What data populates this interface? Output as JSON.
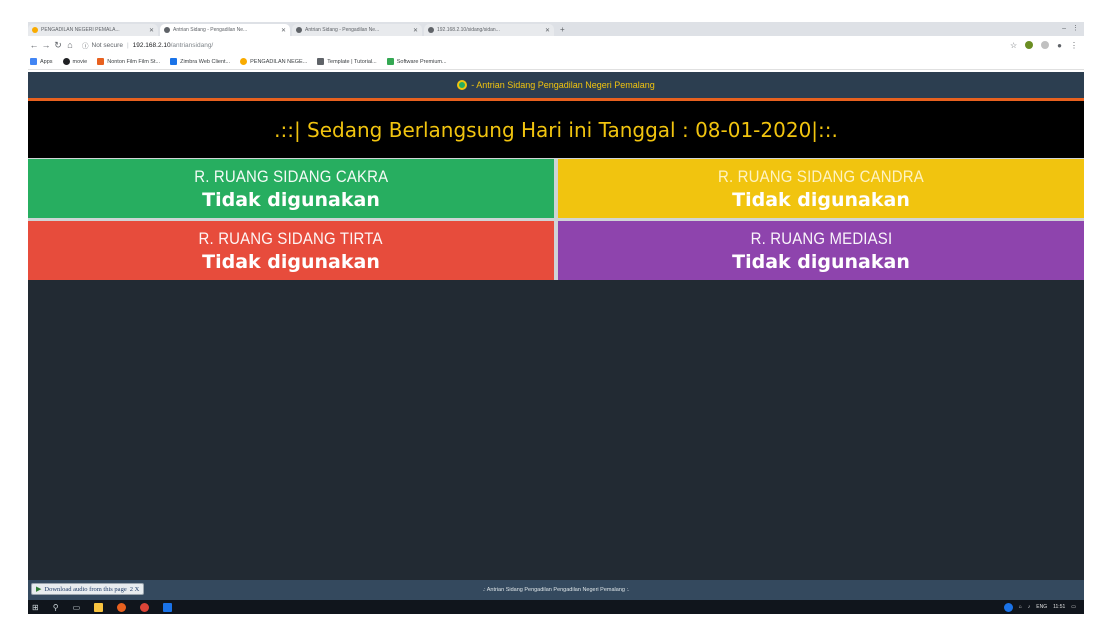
{
  "browser": {
    "tabs": [
      {
        "label": "PENGADILAN NEGERI PEMALA...",
        "active": false
      },
      {
        "label": "Antrian Sidang - Pengadilan Ne...",
        "active": true
      },
      {
        "label": "Antrian Sidang - Pengadilan Ne...",
        "active": false
      },
      {
        "label": "192.168.2.10/sidang/sidan...",
        "active": false
      }
    ],
    "new_tab": "+",
    "security_label": "Not secure",
    "url_host": "192.168.2.10",
    "url_path": "/antriansidang/",
    "bookmarks": [
      {
        "label": "Apps",
        "color": "#4285f4"
      },
      {
        "label": "movie",
        "color": "#202124"
      },
      {
        "label": "Nonton Film Film St...",
        "color": "#e8611f"
      },
      {
        "label": "Zimbra Web Client...",
        "color": "#1a73e8"
      },
      {
        "label": "PENGADILAN NEGE...",
        "color": "#f9ab00"
      },
      {
        "label": "Template | Tutorial...",
        "color": "#5f6368"
      },
      {
        "label": "Software Premium...",
        "color": "#34a853"
      }
    ]
  },
  "header": {
    "title": "- Antrian Sidang Pengadilan Negeri Pemalang"
  },
  "banner": {
    "text": ".::| Sedang Berlangsung Hari ini Tanggal : 08-01-2020|::."
  },
  "rooms": [
    {
      "name": "R. RUANG SIDANG CAKRA",
      "status": "Tidak digunakan",
      "color": "#27ae60"
    },
    {
      "name": "R. RUANG SIDANG CANDRA",
      "status": "Tidak digunakan",
      "color": "#f1c40f"
    },
    {
      "name": "R. RUANG SIDANG TIRTA",
      "status": "Tidak digunakan",
      "color": "#e74c3c"
    },
    {
      "name": "R. RUANG MEDIASI",
      "status": "Tidak digunakan",
      "color": "#8e44ad"
    }
  ],
  "download_box": {
    "label": "Download audio from this page",
    "extra": "2 X"
  },
  "footer": {
    "text": ".: Antrian Sidang Pengadilan Pengadilan Negeri Pemalang :."
  },
  "taskbar": {
    "lang": "ENG",
    "time": "11:51"
  },
  "colors": {
    "accent_orange": "#e8611f",
    "title_yellow": "#f1c40f",
    "page_bg": "#222a33"
  }
}
